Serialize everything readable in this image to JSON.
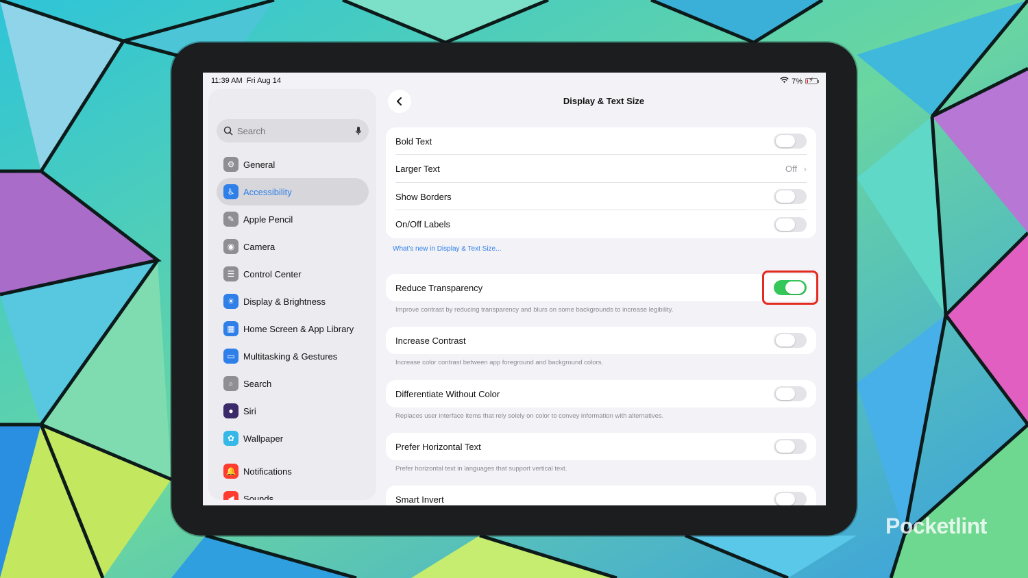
{
  "status": {
    "time": "11:39 AM",
    "date": "Fri Aug 14",
    "battery": "7%"
  },
  "sidebar": {
    "search_placeholder": "Search",
    "items": [
      {
        "label": "General",
        "icon": "gear-icon",
        "color": "#8e8e93",
        "glyph": "⚙"
      },
      {
        "label": "Accessibility",
        "icon": "accessibility-icon",
        "color": "#2f7fe8",
        "glyph": "♿",
        "active": true
      },
      {
        "label": "Apple Pencil",
        "icon": "pencil-icon",
        "color": "#8e8e93",
        "glyph": "✎"
      },
      {
        "label": "Camera",
        "icon": "camera-icon",
        "color": "#8e8e93",
        "glyph": "◉"
      },
      {
        "label": "Control Center",
        "icon": "control-center-icon",
        "color": "#8e8e93",
        "glyph": "☰"
      },
      {
        "label": "Display & Brightness",
        "icon": "brightness-icon",
        "color": "#2f7fe8",
        "glyph": "☀"
      },
      {
        "label": "Home Screen & App Library",
        "icon": "home-screen-icon",
        "color": "#2f7fe8",
        "glyph": "▦"
      },
      {
        "label": "Multitasking & Gestures",
        "icon": "multitasking-icon",
        "color": "#2f7fe8",
        "glyph": "▭"
      },
      {
        "label": "Search",
        "icon": "search-icon",
        "color": "#8e8e93",
        "glyph": "⌕"
      },
      {
        "label": "Siri",
        "icon": "siri-icon",
        "color": "#3a2a6a",
        "glyph": "●"
      },
      {
        "label": "Wallpaper",
        "icon": "wallpaper-icon",
        "color": "#35b8e8",
        "glyph": "✿"
      },
      {
        "label": "Notifications",
        "icon": "bell-icon",
        "color": "#ff3b30",
        "glyph": "🔔"
      },
      {
        "label": "Sounds",
        "icon": "speaker-icon",
        "color": "#ff3b30",
        "glyph": "◀"
      }
    ]
  },
  "header": {
    "title": "Display & Text Size"
  },
  "group1": [
    {
      "label": "Bold Text",
      "toggle": "off"
    },
    {
      "label": "Larger Text",
      "value": "Off"
    },
    {
      "label": "Show Borders",
      "toggle": "off"
    },
    {
      "label": "On/Off Labels",
      "toggle": "off"
    }
  ],
  "link": "What's new in Display & Text Size...",
  "settings": [
    {
      "label": "Reduce Transparency",
      "toggle": "on",
      "footer": "Improve contrast by reducing transparency and blurs on some backgrounds to increase legibility."
    },
    {
      "label": "Increase Contrast",
      "toggle": "off",
      "footer": "Increase color contrast between app foreground and background colors."
    },
    {
      "label": "Differentiate Without Color",
      "toggle": "off",
      "footer": "Replaces user interface items that rely solely on color to convey information with alternatives."
    },
    {
      "label": "Prefer Horizontal Text",
      "toggle": "off",
      "footer": "Prefer horizontal text in languages that support vertical text."
    },
    {
      "label": "Smart Invert",
      "toggle": "off",
      "footer": ""
    }
  ],
  "watermark": "Pocketlint",
  "colors": {
    "accent": "#2f7fe8",
    "toggle_on": "#35c759",
    "highlight": "#e32b1f"
  }
}
